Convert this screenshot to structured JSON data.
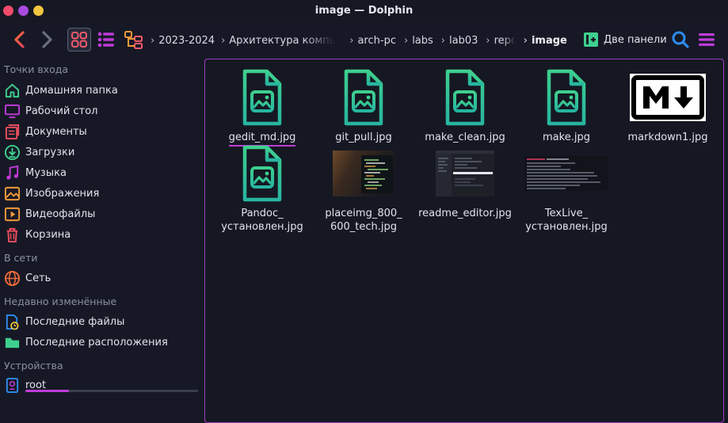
{
  "window": {
    "title": "image — Dolphin"
  },
  "toolbar": {
    "breadcrumbs": [
      "2023-2024",
      "Архитектура компьютеров",
      "arch-pc",
      "labs",
      "lab03",
      "report",
      "image"
    ],
    "split_label": "Две панели"
  },
  "sidebar": {
    "sections": {
      "places": "Точки входа",
      "network": "В сети",
      "recent": "Недавно изменённые",
      "devices": "Устройства"
    },
    "places": [
      {
        "label": "Домашняя папка",
        "icon": "home-icon",
        "color": "#3ecf8e"
      },
      {
        "label": "Рабочий стол",
        "icon": "desktop-icon",
        "color": "#c03ad9"
      },
      {
        "label": "Документы",
        "icon": "documents-icon",
        "color": "#ef4f5f"
      },
      {
        "label": "Загрузки",
        "icon": "downloads-icon",
        "color": "#3ecf8e"
      },
      {
        "label": "Музыка",
        "icon": "music-icon",
        "color": "#c03ad9"
      },
      {
        "label": "Изображения",
        "icon": "pictures-icon",
        "color": "#f39a3a"
      },
      {
        "label": "Видеофайлы",
        "icon": "videos-icon",
        "color": "#f39a3a"
      },
      {
        "label": "Корзина",
        "icon": "trash-icon",
        "color": "#ef4f5f"
      }
    ],
    "network": [
      {
        "label": "Сеть",
        "icon": "network-icon"
      }
    ],
    "recent": [
      {
        "label": "Последние файлы",
        "icon": "recent-files-icon"
      },
      {
        "label": "Последние расположения",
        "icon": "recent-locations-icon"
      }
    ],
    "devices": [
      {
        "label": "root",
        "icon": "drive-icon",
        "usage_fraction": 0.25
      }
    ]
  },
  "files": [
    {
      "line1": "gedit_md.jpg",
      "line2": "",
      "thumb": "image-file-icon",
      "selected": true
    },
    {
      "line1": "git_pull.jpg",
      "line2": "",
      "thumb": "image-file-icon"
    },
    {
      "line1": "make_clean.jpg",
      "line2": "",
      "thumb": "image-file-icon"
    },
    {
      "line1": "make.jpg",
      "line2": "",
      "thumb": "image-file-icon"
    },
    {
      "line1": "markdown1.jpg",
      "line2": "",
      "thumb": "markdown-logo"
    },
    {
      "line1": "Pandoc_",
      "line2": "установлен.jpg",
      "thumb": "image-file-icon"
    },
    {
      "line1": "placeimg_800_",
      "line2": "600_tech.jpg",
      "thumb": "tech-photo"
    },
    {
      "line1": "readme_editor.jpg",
      "line2": "",
      "thumb": "editor-screenshot"
    },
    {
      "line1": "TexLive_",
      "line2": "установлен.jpg",
      "thumb": "terminal-screenshot"
    }
  ],
  "colors": {
    "accent": "#c03ad9",
    "green": "#3ecf8e",
    "orange": "#f39a3a",
    "background": "#161925"
  }
}
